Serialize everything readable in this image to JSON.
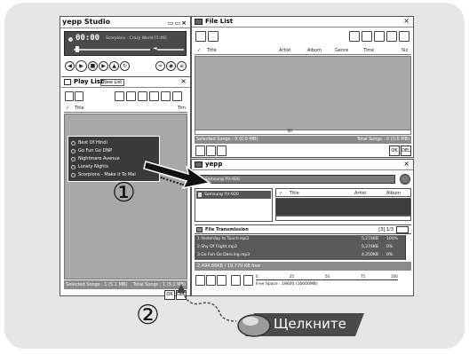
{
  "studio": {
    "title": "yepp Studio",
    "track_time": "00:00",
    "track_info": "Scorpions - Crazy World [5:49]",
    "controls": [
      "|◀◀",
      "▶",
      "■",
      "▶▶|",
      "⏏",
      "⟲"
    ],
    "playlist": {
      "title": "Play List",
      "tab": "New List",
      "header_check": "✓",
      "header_title": "Title",
      "header_time": "Tim",
      "items": [
        "Best Of Hindi",
        "Go Fun Go DNP",
        "Nightmare Avenue",
        "Lonely Nights",
        "Scorpions - Make it To Mal"
      ],
      "status_left": "Selected Songs : 1 (5.1 MB)",
      "status_right": "Total Songs : 1 (5.1 MB)",
      "btn_ok": "OK",
      "btn_del": "DEL"
    }
  },
  "filelist": {
    "title": "File List",
    "columns": [
      "✓",
      "Title",
      "Artist",
      "Album",
      "Genre",
      "Time",
      "Siz"
    ],
    "status_left": "Selected Songs : 0 (0.0 MB)",
    "status_right": "Total Songs : 0 (0.0 MB)",
    "btn_ok": "OK",
    "btn_del": "DEL",
    "scroll_mark": "IIII"
  },
  "yepp": {
    "title": "yepp",
    "device": "Samsung YH-920",
    "tree_item": "Samsung YH-920",
    "columns": [
      "✓",
      "Title",
      "Artist",
      "Album"
    ],
    "transfer": {
      "title": "File Transmission",
      "counter": "[3] 1/3",
      "rows": [
        {
          "name": "1.Yesterday to Touch.mp3",
          "size": "5,274KB",
          "pct": "100%"
        },
        {
          "name": "2.Shy Of Flight.mp3",
          "size": "5,274KB",
          "pct": "0%"
        },
        {
          "name": "3.Go Fun Go Dancing.mp3",
          "size": "4,250KB",
          "pct": "0%"
        }
      ]
    },
    "capacity_status": "2,494.86KB / 19,779 KB free",
    "free_space": "Free Space : 19600 (16000MB)",
    "scale": [
      "0",
      "25",
      "50",
      "75",
      "100"
    ]
  },
  "callouts": {
    "one": "①",
    "two": "②",
    "click_label": "Щелкните"
  }
}
